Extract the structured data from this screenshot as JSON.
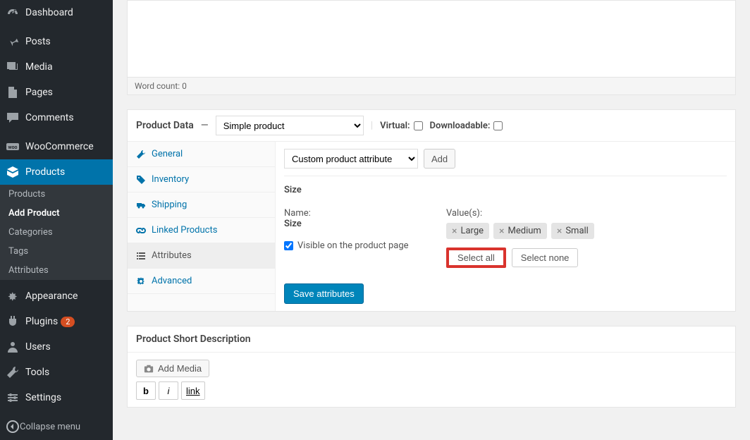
{
  "sidebar": {
    "items": [
      {
        "label": "Dashboard"
      },
      {
        "label": "Posts"
      },
      {
        "label": "Media"
      },
      {
        "label": "Pages"
      },
      {
        "label": "Comments"
      },
      {
        "label": "WooCommerce"
      },
      {
        "label": "Products"
      },
      {
        "label": "Appearance"
      },
      {
        "label": "Plugins",
        "badge": "2"
      },
      {
        "label": "Users"
      },
      {
        "label": "Tools"
      },
      {
        "label": "Settings"
      }
    ],
    "submenu": [
      {
        "label": "Products"
      },
      {
        "label": "Add Product"
      },
      {
        "label": "Categories"
      },
      {
        "label": "Tags"
      },
      {
        "label": "Attributes"
      }
    ],
    "collapse": "Collapse menu"
  },
  "editor": {
    "wordcount": "Word count: 0"
  },
  "product_data": {
    "title": "Product Data",
    "dash": "—",
    "type_selected": "Simple product",
    "virtual_label": "Virtual:",
    "downloadable_label": "Downloadable:",
    "tabs": [
      {
        "label": "General"
      },
      {
        "label": "Inventory"
      },
      {
        "label": "Shipping"
      },
      {
        "label": "Linked Products"
      },
      {
        "label": "Attributes"
      },
      {
        "label": "Advanced"
      }
    ],
    "attr_dropdown": "Custom product attribute",
    "add_btn": "Add",
    "attr": {
      "title": "Size",
      "name_label": "Name:",
      "name_value": "Size",
      "visible_label": "Visible on the product page",
      "values_label": "Value(s):",
      "chips": [
        "Large",
        "Medium",
        "Small"
      ],
      "select_all": "Select all",
      "select_none": "Select none"
    },
    "save_btn": "Save attributes"
  },
  "short_desc": {
    "title": "Product Short Description",
    "add_media": "Add Media",
    "b": "b",
    "i": "i",
    "link": "link"
  }
}
